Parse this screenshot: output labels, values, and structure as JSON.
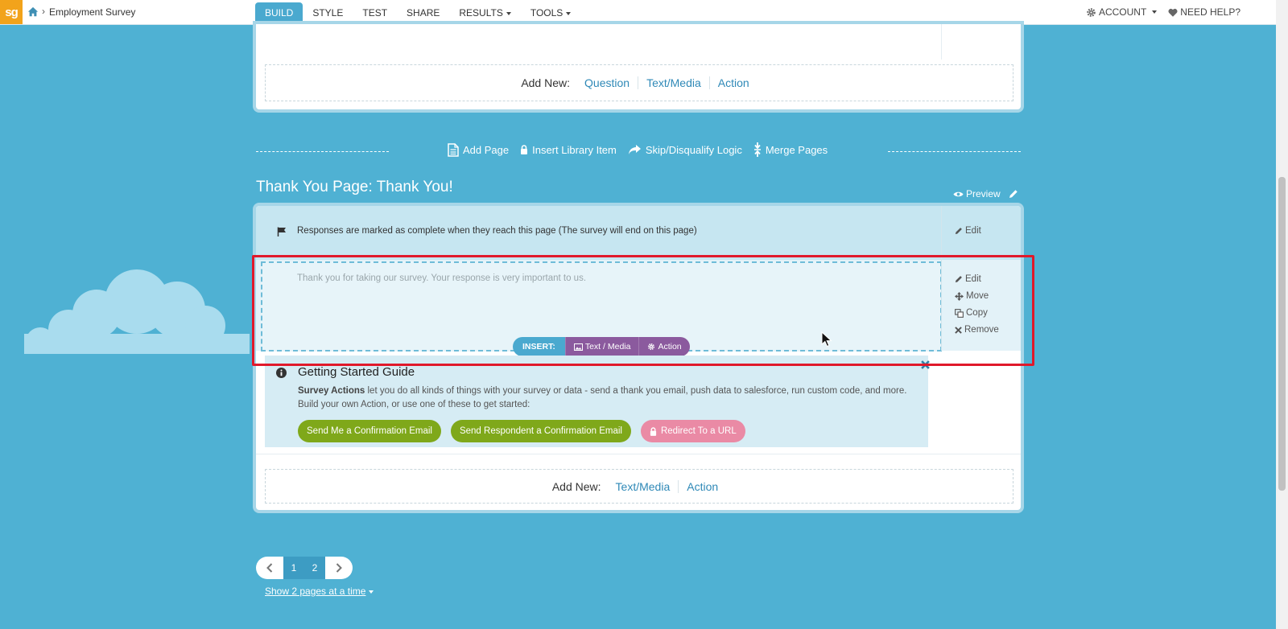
{
  "topbar": {
    "logo": "sg",
    "breadcrumb": "Employment Survey",
    "nav": [
      {
        "label": "BUILD",
        "active": true
      },
      {
        "label": "STYLE",
        "active": false
      },
      {
        "label": "TEST",
        "active": false
      },
      {
        "label": "SHARE",
        "active": false
      },
      {
        "label": "RESULTS",
        "active": false,
        "dropdown": true
      },
      {
        "label": "TOOLS",
        "active": false,
        "dropdown": true
      }
    ],
    "account": "ACCOUNT",
    "help": "NEED HELP?"
  },
  "page1": {
    "addnew_label": "Add New:",
    "addnew_links": [
      "Question",
      "Text/Media",
      "Action"
    ]
  },
  "page_tools": {
    "add_page": "Add Page",
    "insert_library": "Insert Library Item",
    "skip_logic": "Skip/Disqualify Logic",
    "merge_pages": "Merge Pages"
  },
  "thankyou": {
    "title": "Thank You Page: Thank You!",
    "preview": "Preview",
    "complete_text": "Responses are marked as complete when they reach this page (The survey will end on this page)",
    "complete_edit": "Edit",
    "message": "Thank you for taking our survey. Your response is very important to us.",
    "side_actions": [
      "Edit",
      "Move",
      "Copy",
      "Remove"
    ],
    "insert": {
      "label": "INSERT:",
      "text_media": "Text / Media",
      "action": "Action"
    },
    "guide": {
      "title": "Getting Started Guide",
      "desc_bold": "Survey Actions",
      "desc_rest": " let you do all kinds of things with your survey or data - send a thank you email, push data to salesforce, run custom code, and more. Build your own Action, or use one of these to get started:",
      "buttons": [
        "Send Me a Confirmation Email",
        "Send Respondent a Confirmation Email",
        "Redirect To a URL"
      ]
    },
    "addnew_label": "Add New:",
    "addnew_links": [
      "Text/Media",
      "Action"
    ]
  },
  "pagination": {
    "pages": [
      "1",
      "2"
    ],
    "toggle": "Show 2 pages at a time"
  },
  "colors": {
    "background": "#4fb1d3",
    "accent": "#4aa9cf",
    "action_purple": "#8b5a9e",
    "green_button": "#7fa81a",
    "pink_button": "#ea8aa5",
    "highlight": "#e0192b"
  }
}
